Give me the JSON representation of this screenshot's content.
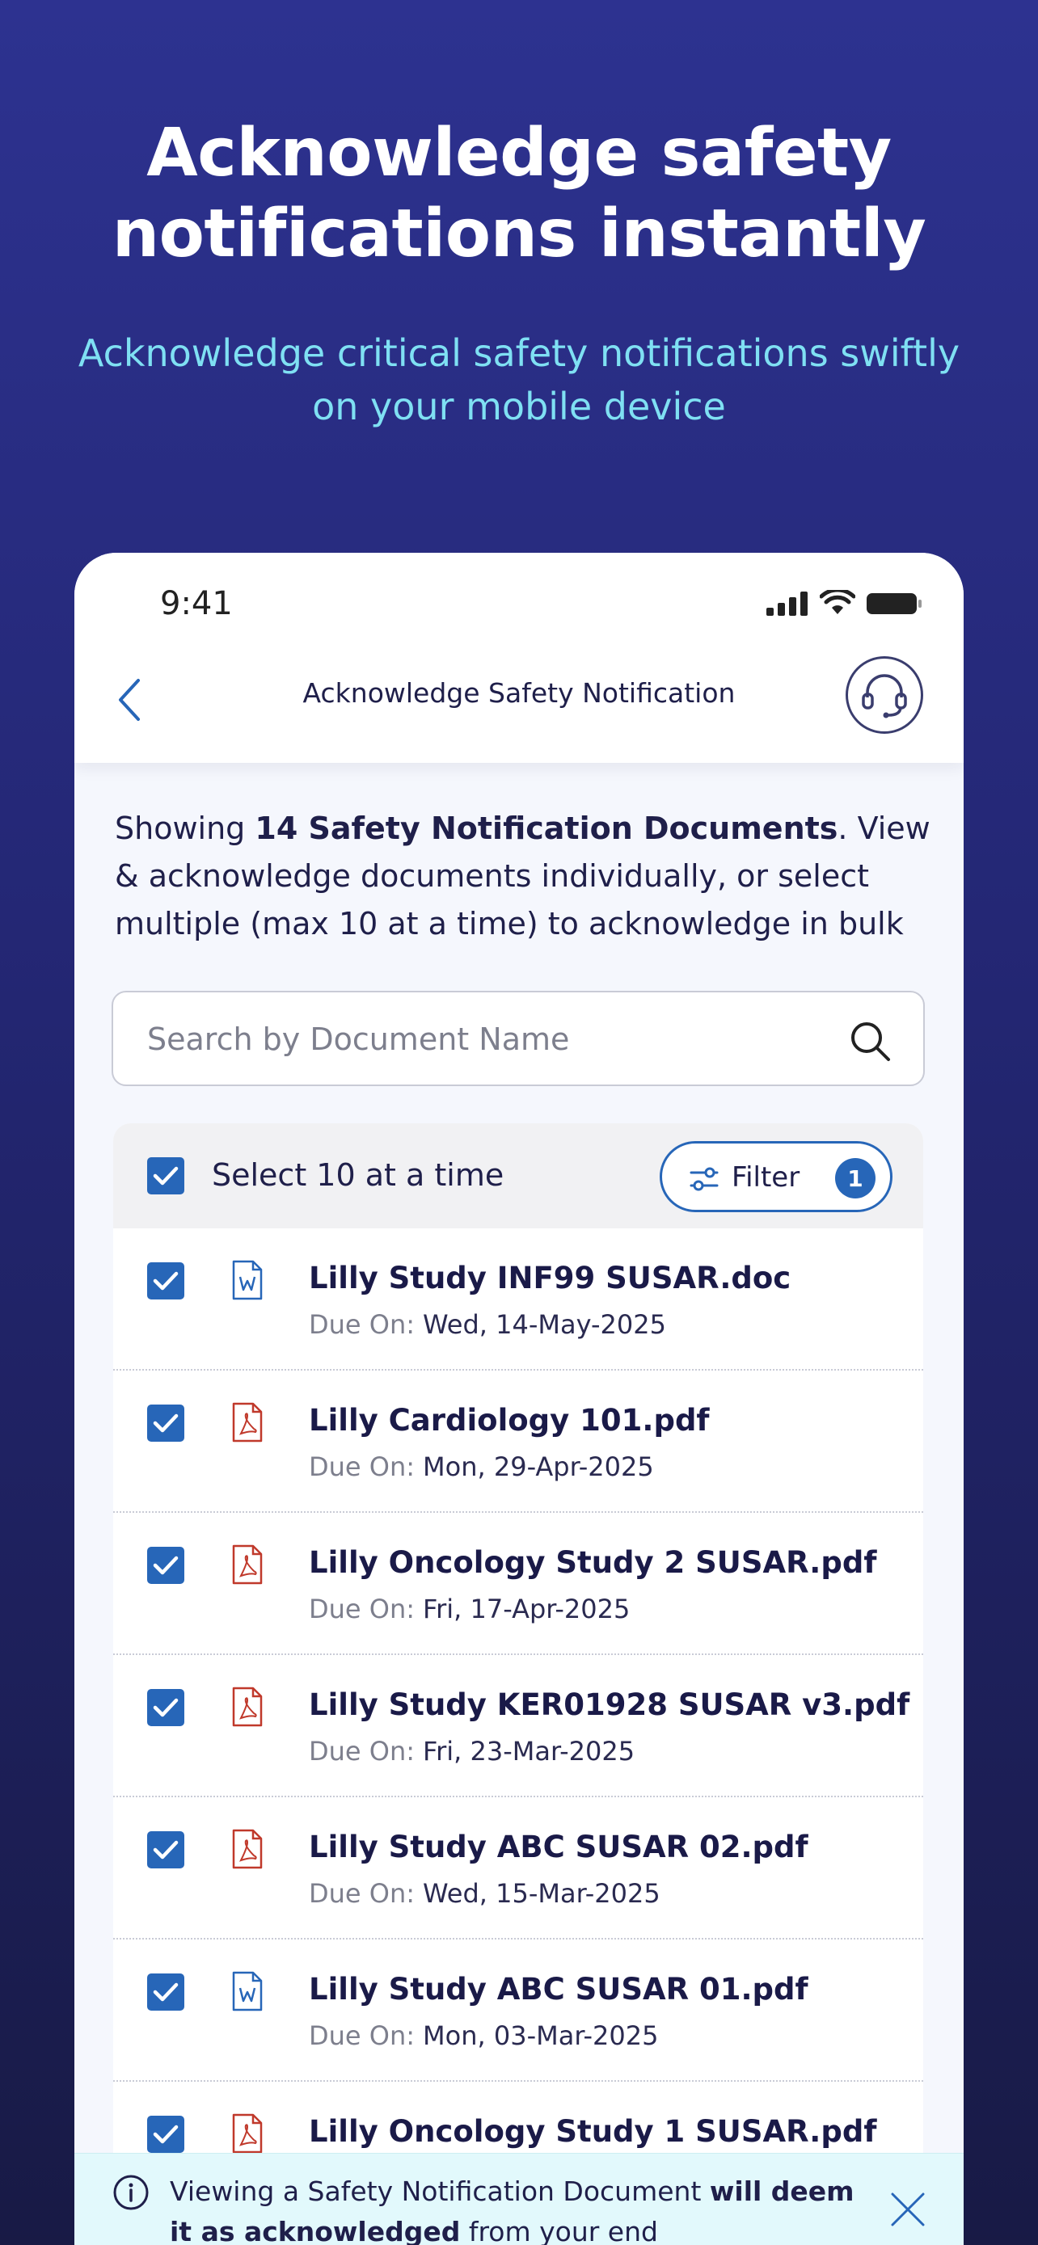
{
  "hero": {
    "title_line1": "Acknowledge safety",
    "title_line2": "notifications instantly",
    "subtitle_line1": "Acknowledge critical safety notifications swiftly",
    "subtitle_line2": "on your mobile device"
  },
  "status_bar": {
    "time": "9:41"
  },
  "nav": {
    "title": "Acknowledge Safety Notification",
    "back_icon": "chevron-left-icon",
    "support_icon": "headset-icon"
  },
  "intro": {
    "prefix": "Showing ",
    "bold": "14 Safety Notification Documents",
    "suffix": ". View & acknowledge documents individually, or select multiple (max 10 at a time) to acknowledge in bulk"
  },
  "search": {
    "placeholder": "Search by Document Name",
    "value": ""
  },
  "list_header": {
    "select_label": "Select 10 at a time",
    "select_checked": true,
    "filter_label": "Filter",
    "filter_count": "1"
  },
  "due_label": "Due On:",
  "documents": [
    {
      "name": "Lilly Study INF99 SUSAR.doc",
      "due": "Wed, 14-May-2025",
      "type": "doc",
      "checked": true
    },
    {
      "name": "Lilly Cardiology 101.pdf",
      "due": "Mon, 29-Apr-2025",
      "type": "pdf",
      "checked": true
    },
    {
      "name": "Lilly Oncology Study 2 SUSAR.pdf",
      "due": "Fri, 17-Apr-2025",
      "type": "pdf",
      "checked": true
    },
    {
      "name": "Lilly Study KER01928 SUSAR v3.pdf",
      "due": "Fri, 23-Mar-2025",
      "type": "pdf",
      "checked": true
    },
    {
      "name": "Lilly Study ABC SUSAR 02.pdf",
      "due": "Wed, 15-Mar-2025",
      "type": "pdf",
      "checked": true
    },
    {
      "name": "Lilly Study ABC SUSAR 01.pdf",
      "due": "Mon, 03-Mar-2025",
      "type": "doc",
      "checked": true
    },
    {
      "name": "Lilly Oncology Study 1 SUSAR.pdf",
      "due": "",
      "type": "pdf",
      "checked": true
    }
  ],
  "banner": {
    "part1": "Viewing a Safety Notification Document ",
    "bold": "will deem it as acknowledged",
    "part2": " from your end"
  },
  "colors": {
    "accent": "#2766b8",
    "pdf_icon": "#c0392b",
    "doc_icon": "#2766b8",
    "hero_subtitle": "#7fe0f3",
    "banner_bg": "#e2f9fc"
  }
}
